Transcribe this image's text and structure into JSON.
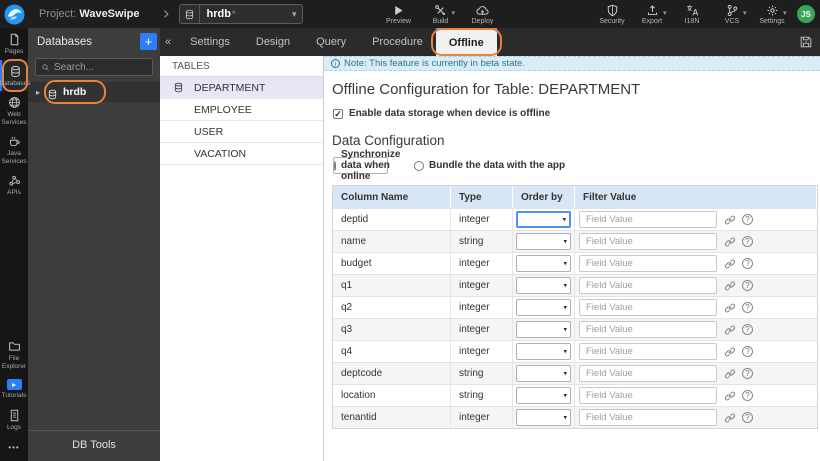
{
  "topbar": {
    "project_label": "Project:",
    "project_name": "WaveSwipe",
    "db_selector": "hrdb",
    "modified_indicator": "*",
    "avatar": "JS",
    "actions_left": [
      {
        "label": "Preview",
        "icon": "play",
        "name": "preview-button",
        "caret": false
      },
      {
        "label": "Build",
        "icon": "build",
        "name": "build-button",
        "caret": true
      },
      {
        "label": "Deploy",
        "icon": "deploy",
        "name": "deploy-button",
        "caret": false
      }
    ],
    "actions_right": [
      {
        "label": "Security",
        "icon": "shield",
        "name": "security-button",
        "caret": false
      },
      {
        "label": "Export",
        "icon": "export",
        "name": "export-button",
        "caret": true
      },
      {
        "label": "I18N",
        "icon": "i18n",
        "name": "i18n-button",
        "caret": false
      },
      {
        "label": "VCS",
        "icon": "vcs",
        "name": "vcs-button",
        "caret": true
      },
      {
        "label": "Settings",
        "icon": "gear",
        "name": "settings-button",
        "caret": true
      }
    ]
  },
  "sidebar": {
    "top_items": [
      {
        "label": "Pages",
        "icon": "page",
        "name": "sidebar-item-pages",
        "active": false
      },
      {
        "label": "Databases",
        "icon": "db",
        "name": "sidebar-item-databases",
        "active": true
      },
      {
        "label": "Web Services",
        "icon": "globe",
        "name": "sidebar-item-web-services",
        "active": false
      },
      {
        "label": "Java Services",
        "icon": "coffee",
        "name": "sidebar-item-java-services",
        "active": false
      },
      {
        "label": "APIs",
        "icon": "api",
        "name": "sidebar-item-apis",
        "active": false
      }
    ],
    "bottom_items": [
      {
        "label": "File Explorer",
        "icon": "folder",
        "name": "sidebar-item-file-explorer",
        "active": false
      },
      {
        "label": "Tutorials",
        "icon": "playtile",
        "name": "sidebar-item-tutorials",
        "active": false
      },
      {
        "label": "Logs",
        "icon": "logs",
        "name": "sidebar-item-logs",
        "active": false
      }
    ],
    "more_label": "•••"
  },
  "db_panel": {
    "title": "Databases",
    "add_label": "+",
    "search_placeholder": "Search...",
    "items": [
      {
        "label": "hrdb"
      }
    ],
    "footer": "DB Tools"
  },
  "main": {
    "collapse_glyph": "«",
    "tabs": [
      "Settings",
      "Design",
      "Query",
      "Procedure",
      "Offline"
    ],
    "active_tab": "Offline"
  },
  "tables_panel": {
    "title": "TABLES",
    "items": [
      "DEPARTMENT",
      "EMPLOYEE",
      "USER",
      "VACATION"
    ],
    "selected": "DEPARTMENT"
  },
  "content": {
    "note": "Note: This feature is currently in beta state.",
    "title": "Offline Configuration for Table: DEPARTMENT",
    "enable_checkbox_label": "Enable data storage when device is offline",
    "enable_checkbox_checked": true,
    "section_title": "Data Configuration",
    "radio_options": [
      {
        "label": "Synchronize data when online",
        "selected": true
      },
      {
        "label": "Bundle the data with the app",
        "selected": false
      }
    ],
    "table": {
      "headers": [
        "Column Name",
        "Type",
        "Order by",
        "Filter Value"
      ],
      "filter_placeholder": "Field Value",
      "rows": [
        {
          "name": "deptid",
          "type": "integer"
        },
        {
          "name": "name",
          "type": "string"
        },
        {
          "name": "budget",
          "type": "integer"
        },
        {
          "name": "q1",
          "type": "integer"
        },
        {
          "name": "q2",
          "type": "integer"
        },
        {
          "name": "q3",
          "type": "integer"
        },
        {
          "name": "q4",
          "type": "integer"
        },
        {
          "name": "deptcode",
          "type": "string"
        },
        {
          "name": "location",
          "type": "string"
        },
        {
          "name": "tenantid",
          "type": "integer"
        }
      ]
    }
  },
  "icons": {
    "caret_down": "▾",
    "caret_right": "▸",
    "check": "✓",
    "info": "i",
    "question": "?"
  },
  "colors": {
    "accent_blue": "#2d7ff9",
    "annotation_orange": "#e8823c",
    "note_bg": "#d9edf7",
    "note_text": "#31708f",
    "table_header_bg": "#d7e6f4",
    "selected_table_bg": "#e6e6f6",
    "avatar_bg": "#3aa557",
    "focused_select_border": "#4d90fe"
  }
}
